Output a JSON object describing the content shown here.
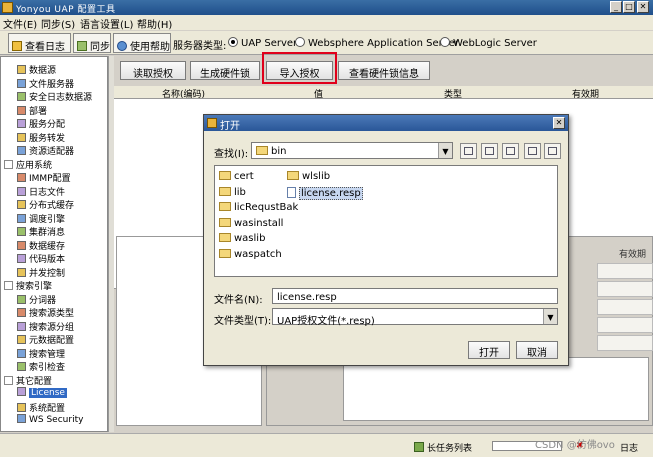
{
  "window": {
    "title": "Yonyou UAP 配置工具"
  },
  "menu": [
    "文件(E)",
    "同步(S)",
    "语言设置(L)",
    "帮助(H)"
  ],
  "toolbar": {
    "view_log": "查看日志",
    "sync": "同步",
    "help": "使用帮助",
    "server_type_label": "服务器类型:",
    "servers": [
      "UAP Server",
      "Websphere Application Server",
      "WebLogic Server"
    ],
    "selected_server": "UAP Server"
  },
  "sidebar": {
    "items": [
      {
        "label": "数据源",
        "indent": 1
      },
      {
        "label": "文件服务器",
        "indent": 1
      },
      {
        "label": "安全日志数据源",
        "indent": 1
      },
      {
        "label": "部署",
        "indent": 1
      },
      {
        "label": "服务分配",
        "indent": 1
      },
      {
        "label": "服务转发",
        "indent": 1
      },
      {
        "label": "资源适配器",
        "indent": 1
      },
      {
        "label": "应用系统",
        "indent": 0
      },
      {
        "label": "IMMP配置",
        "indent": 1
      },
      {
        "label": "日志文件",
        "indent": 1
      },
      {
        "label": "分布式缓存",
        "indent": 1
      },
      {
        "label": "调度引擎",
        "indent": 1
      },
      {
        "label": "集群消息",
        "indent": 1
      },
      {
        "label": "数据缓存",
        "indent": 1
      },
      {
        "label": "代码版本",
        "indent": 1
      },
      {
        "label": "并发控制",
        "indent": 1
      },
      {
        "label": "搜索引擎",
        "indent": 0
      },
      {
        "label": "分词器",
        "indent": 1
      },
      {
        "label": "搜索源类型",
        "indent": 1
      },
      {
        "label": "搜索源分组",
        "indent": 1
      },
      {
        "label": "元数据配置",
        "indent": 1
      },
      {
        "label": "搜索管理",
        "indent": 1
      },
      {
        "label": "索引检查",
        "indent": 1
      },
      {
        "label": "其它配置",
        "indent": 0
      },
      {
        "label": "License",
        "indent": 1,
        "selected": true
      },
      {
        "label": "系统配置",
        "indent": 1
      },
      {
        "label": "WS Security",
        "indent": 1
      }
    ]
  },
  "main": {
    "buttons": {
      "read_license": "读取授权",
      "gen_hardware_lock": "生成硬件锁",
      "import_license": "导入授权",
      "view_hardware_lock": "查看硬件锁信息"
    },
    "columns": [
      "名称(编码)",
      "值",
      "类型",
      "有效期"
    ],
    "lower_right_header": "有效期"
  },
  "statusbar": {
    "tasks": "长任务列表",
    "log": "日志"
  },
  "dialog": {
    "title": "打开",
    "look_in_label": "查找(I):",
    "look_in_value": "bin",
    "files": [
      {
        "name": "cert",
        "type": "folder"
      },
      {
        "name": "lib",
        "type": "folder"
      },
      {
        "name": "licRequstBak",
        "type": "folder"
      },
      {
        "name": "wasinstall",
        "type": "folder"
      },
      {
        "name": "waslib",
        "type": "folder"
      },
      {
        "name": "waspatch",
        "type": "folder"
      },
      {
        "name": "wlslib",
        "type": "folder"
      },
      {
        "name": "license.resp",
        "type": "file",
        "selected": true
      }
    ],
    "filename_label": "文件名(N):",
    "filename_value": "license.resp",
    "filetype_label": "文件类型(T):",
    "filetype_value": "UAP授权文件(*.resp)",
    "open_button": "打开",
    "cancel_button": "取消"
  },
  "watermark": "CSDN @仿佛ovo"
}
